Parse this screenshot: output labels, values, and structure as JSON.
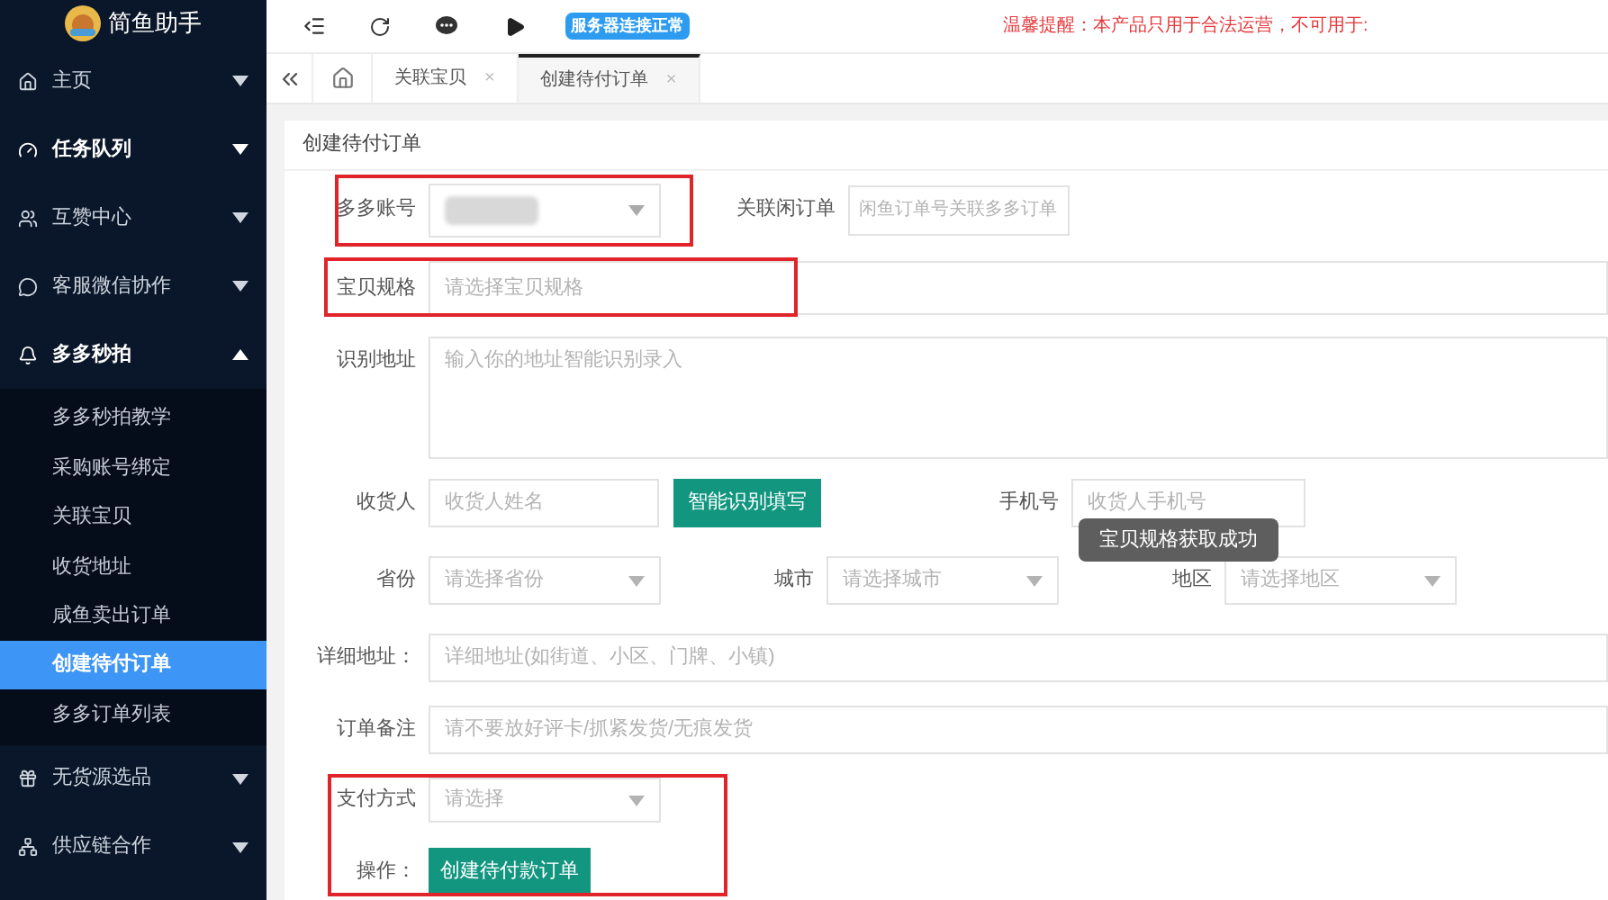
{
  "sidebar": {
    "logo_text": "简鱼助手",
    "items": [
      {
        "label": "主页",
        "expanded": false,
        "bold": false
      },
      {
        "label": "任务队列",
        "expanded": false,
        "bold": true
      },
      {
        "label": "互赞中心",
        "expanded": false,
        "bold": false
      },
      {
        "label": "客服微信协作",
        "expanded": false,
        "bold": false
      },
      {
        "label": "多多秒拍",
        "expanded": true,
        "bold": true,
        "children": [
          {
            "label": "多多秒拍教学",
            "selected": false
          },
          {
            "label": "采购账号绑定",
            "selected": false
          },
          {
            "label": "关联宝贝",
            "selected": false
          },
          {
            "label": "收货地址",
            "selected": false
          },
          {
            "label": "咸鱼卖出订单",
            "selected": false
          },
          {
            "label": "创建待付订单",
            "selected": true
          },
          {
            "label": "多多订单列表",
            "selected": false
          }
        ]
      },
      {
        "label": "无货源选品",
        "expanded": false,
        "bold": false
      },
      {
        "label": "供应链合作",
        "expanded": false,
        "bold": false
      }
    ]
  },
  "toolbar": {
    "status_badge": "服务器连接正常",
    "notice": "温馨提醒：本产品只用于合法运营，不可用于:"
  },
  "tabs": [
    {
      "label": "关联宝贝",
      "selected": false,
      "close": "×"
    },
    {
      "label": "创建待付订单",
      "selected": true,
      "close": "×"
    }
  ],
  "card": {
    "title": "创建待付订单",
    "account": {
      "label": "多多账号",
      "value_redacted": true,
      "highlighted": true
    },
    "linked_order": {
      "label": "关联闲订单",
      "placeholder": "闲鱼订单号关联多多订单"
    },
    "spec": {
      "label": "宝贝规格",
      "placeholder": "请选择宝贝规格",
      "highlighted": true
    },
    "address_recognition": {
      "label": "识别地址",
      "placeholder": "输入你的地址智能识别录入"
    },
    "recipient": {
      "label": "收货人",
      "placeholder": "收货人姓名"
    },
    "smart_fill_button": "智能识别填写",
    "phone": {
      "label": "手机号",
      "placeholder": "收货人手机号"
    },
    "province": {
      "label": "省份",
      "placeholder": "请选择省份"
    },
    "city": {
      "label": "城市",
      "placeholder": "请选择城市"
    },
    "district": {
      "label": "地区",
      "placeholder": "请选择地区"
    },
    "detail_address": {
      "label": "详细地址：",
      "placeholder": "详细地址(如街道、小区、门牌、小镇)"
    },
    "remark": {
      "label": "订单备注",
      "placeholder": "请不要放好评卡/抓紧发货/无痕发货"
    },
    "payment_section": {
      "highlighted": true,
      "payment": {
        "label": "支付方式",
        "placeholder": "请选择"
      },
      "action_label": "操作：",
      "submit_button": "创建待付款订单"
    }
  },
  "toast": "宝贝规格获取成功"
}
